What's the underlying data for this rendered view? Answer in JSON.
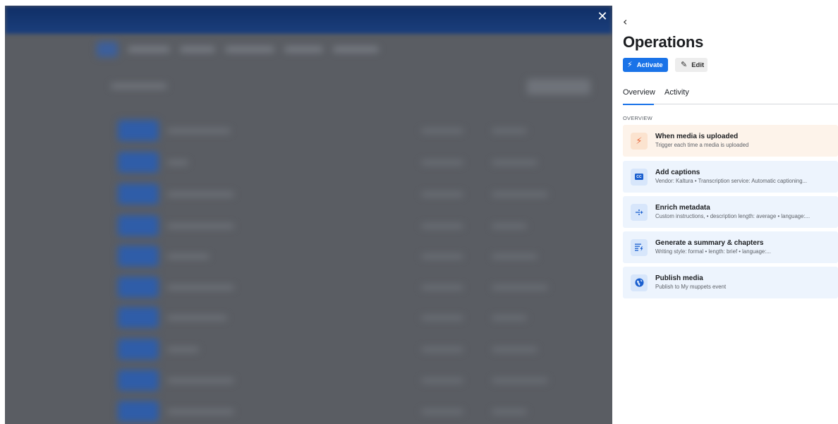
{
  "background": {
    "close_icon": "✕"
  },
  "drawer": {
    "back_icon": "‹",
    "title": "Operations",
    "actions": {
      "activate_label": "Activate",
      "activate_icon": "⚡",
      "edit_label": "Edit",
      "edit_icon": "✎"
    },
    "tabs": [
      {
        "label": "Overview",
        "active": true
      },
      {
        "label": "Activity",
        "active": false
      }
    ],
    "section_label": "OVERVIEW",
    "cards": [
      {
        "kind": "trigger",
        "icon": "lightning-icon",
        "title": "When media is uploaded",
        "subtitle": "Trigger each time a media is uploaded"
      },
      {
        "kind": "step",
        "icon": "captions-icon",
        "icon_text": "CC",
        "title": "Add captions",
        "subtitle": "Vendor: Kaltura • Transcription service: Automatic captioning..."
      },
      {
        "kind": "step",
        "icon": "sparkle-metadata-icon",
        "title": "Enrich metadata",
        "subtitle": "Custom instructions, • description length: average • language:..."
      },
      {
        "kind": "step",
        "icon": "summary-chapters-icon",
        "title": "Generate a summary & chapters",
        "subtitle": "Writing style: formal • length: brief • language:..."
      },
      {
        "kind": "step",
        "icon": "globe-icon",
        "title": "Publish media",
        "subtitle": "Publish to My muppets event"
      }
    ]
  },
  "colors": {
    "accent": "#1a73e8",
    "trigger_bg": "#fdf3ea",
    "trigger_icon": "#e8663a",
    "step_bg": "#edf4fd",
    "overlay": "#5a5d63"
  }
}
